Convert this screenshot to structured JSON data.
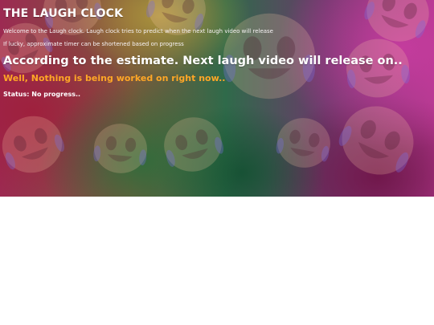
{
  "page": {
    "title": "THE LAUGH CLOCK",
    "intro": "Welcome to the Laugh clock. Laugh clock tries to predict when the next laugh video will release",
    "note": "If lucky, approximate timer can be shortened based on progress",
    "estimate_heading": "According to the estimate. Next laugh video will release on..",
    "current_work": "Well, Nothing is being worked on right now..",
    "status": "Status: No progress.."
  },
  "colors": {
    "current_work_text": "#ffa726",
    "text": "#ffffff",
    "background_below": "#ffffff"
  },
  "background": {
    "decoration": "laughing-face-emoji-pattern"
  }
}
